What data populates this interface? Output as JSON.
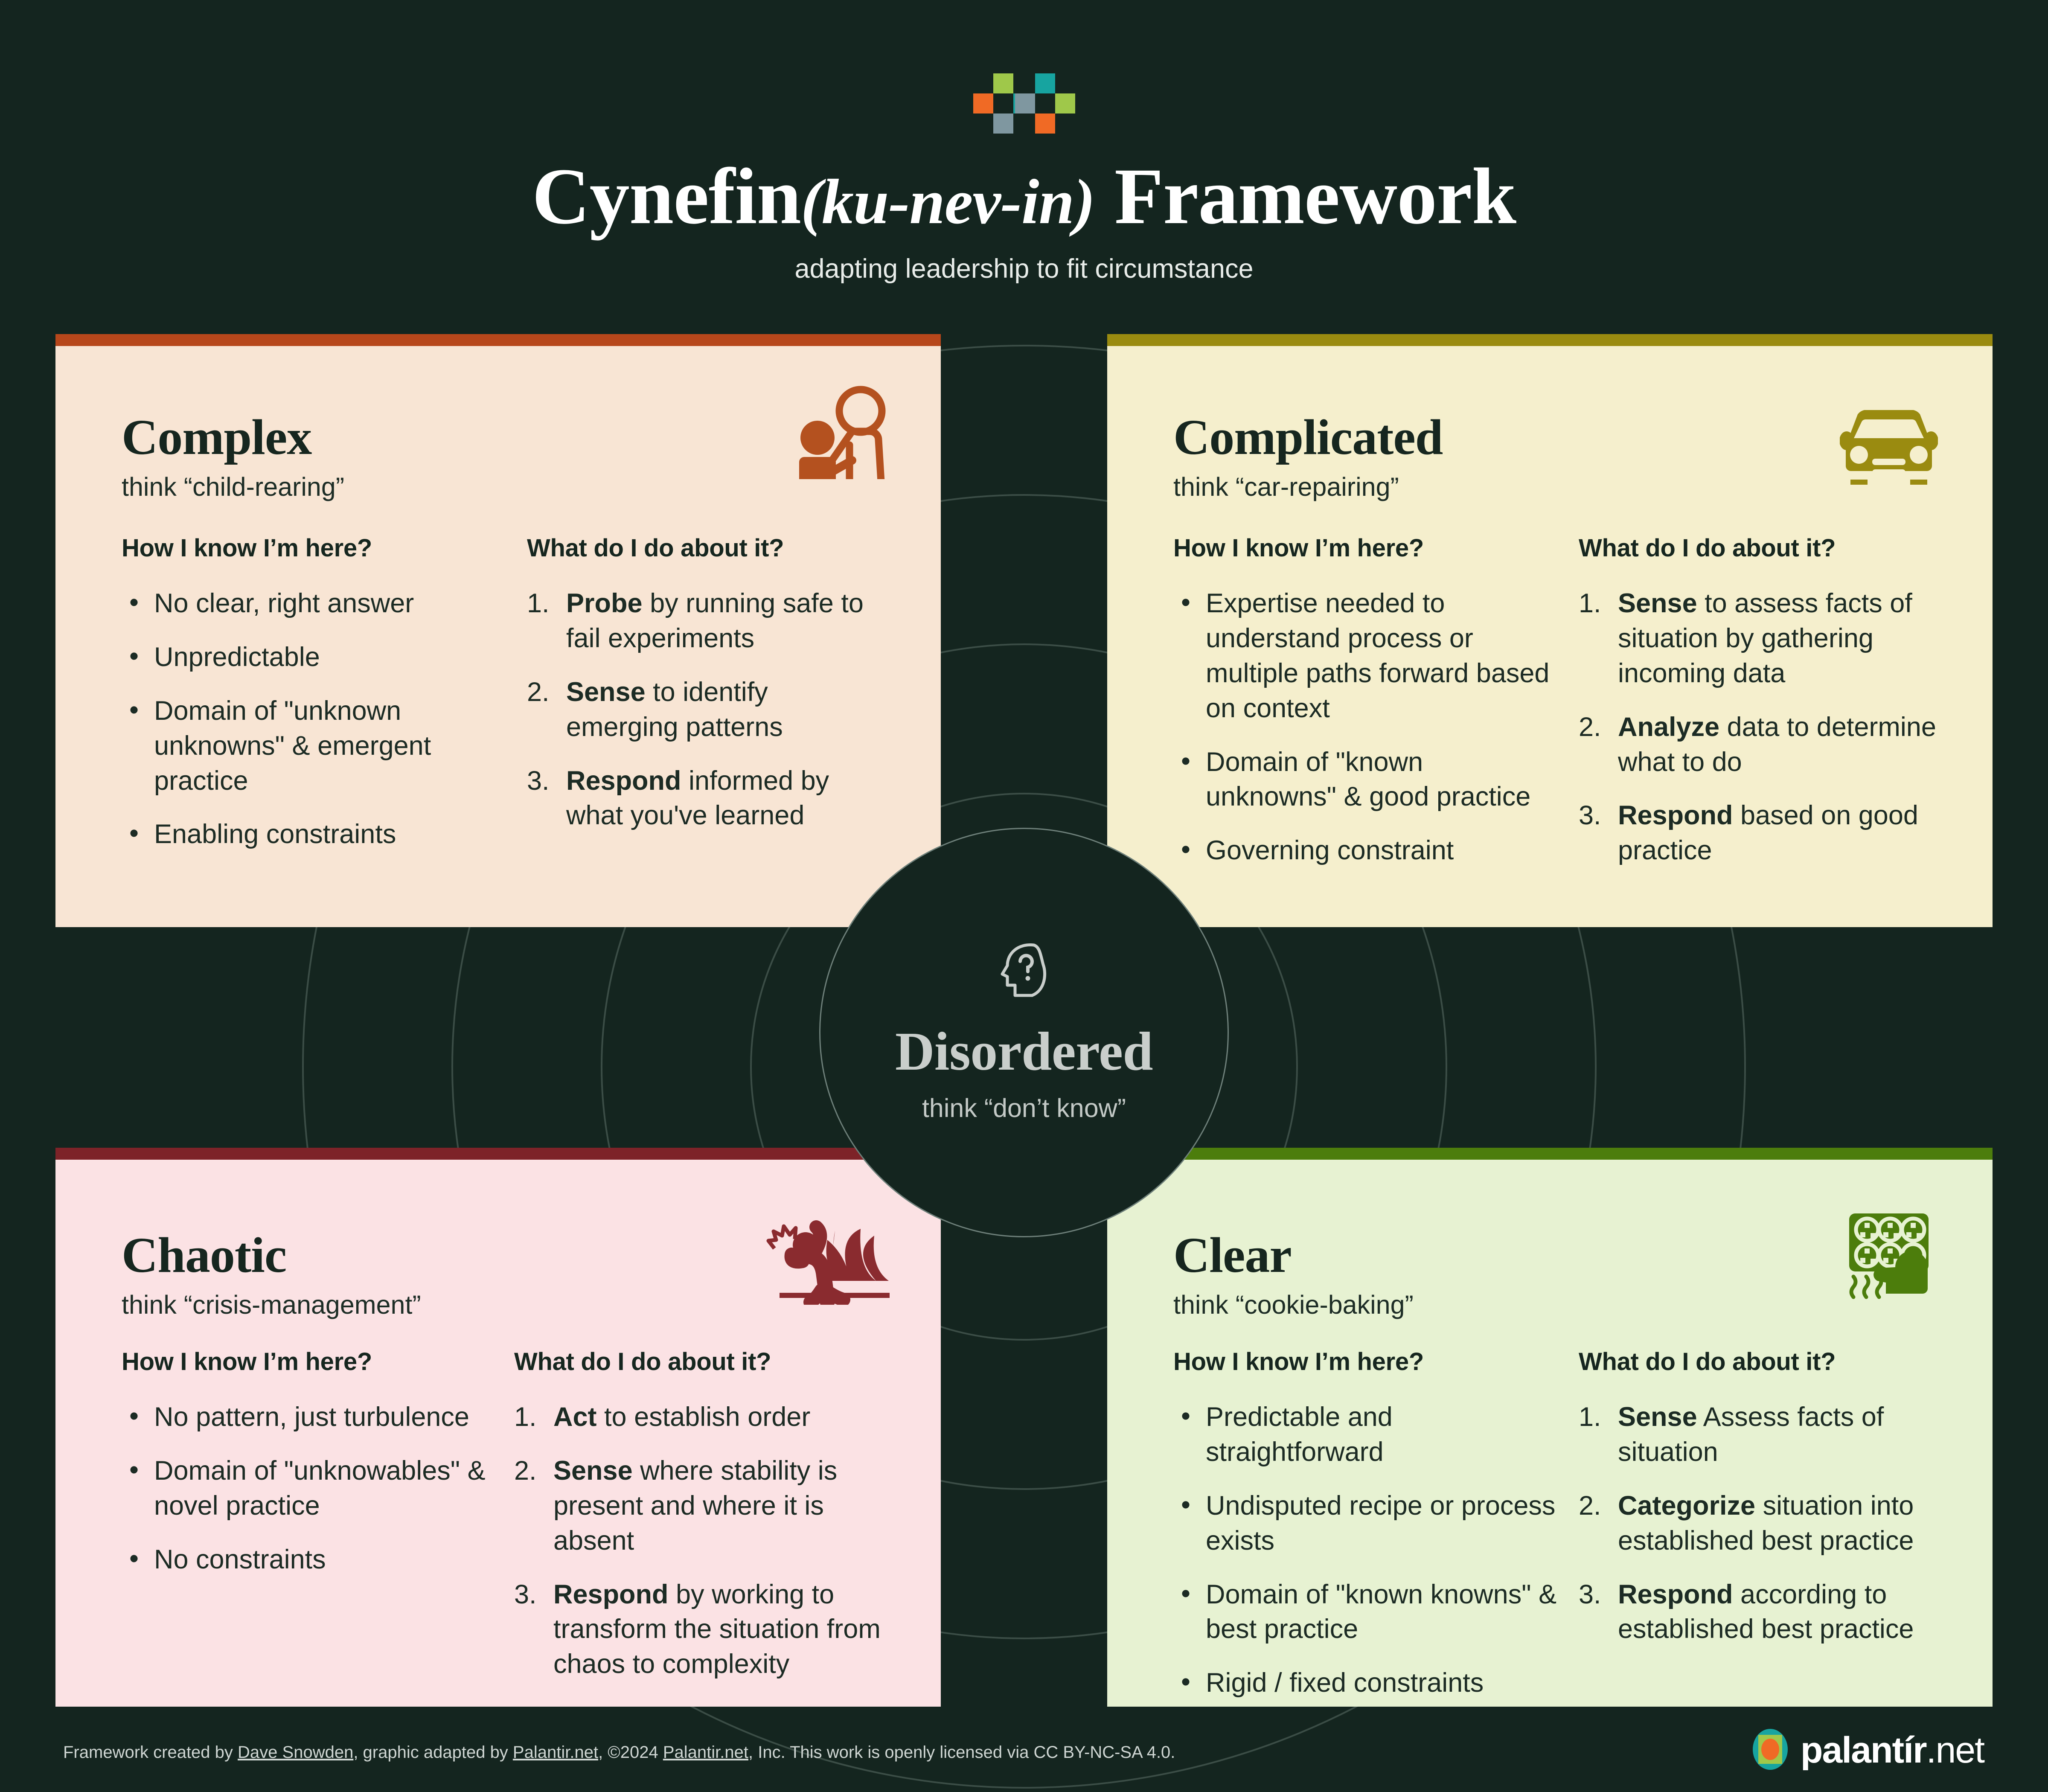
{
  "header": {
    "logo_name": "palantir-squares-logo",
    "title_main": "Cynefin",
    "title_pronunciation": "(ku-nev-in)",
    "title_tail": "Framework",
    "subtitle": "adapting leadership to fit circumstance"
  },
  "colors": {
    "page_bg": "#14251f",
    "complex_bar": "#b7471b",
    "complex_bg": "#f8e5d4",
    "complex_icon": "#b4511f",
    "complicated_bar": "#9a8b10",
    "complicated_bg": "#f5efcd",
    "complicated_icon": "#9a8b10",
    "chaotic_bar": "#7d2328",
    "chaotic_bg": "#fbe2e4",
    "chaotic_icon": "#8a2b2f",
    "clear_bar": "#4c7d0c",
    "clear_bg": "#e7f2d2",
    "clear_icon": "#4c7d0c",
    "logo_green": "#9fc84a",
    "logo_teal": "#17a4a0",
    "logo_orange": "#f06a25",
    "logo_slate": "#7f97a0",
    "ring_stroke": "#3b4d46",
    "center_border": "#6d7f79"
  },
  "quadrants": [
    {
      "id": "complex",
      "title": "Complex",
      "subtitle": "think “child-rearing”",
      "icon_name": "adult-and-child-icon",
      "left_heading": "How I know I’m here?",
      "right_heading": "What do I do about it?",
      "signals": [
        "No clear, right answer",
        "Unpredictable",
        "Domain of \"unknown unknowns\" & emergent practice",
        "Enabling constraints"
      ],
      "actions": [
        {
          "lead": "Probe",
          "rest": "by running safe to fail experiments"
        },
        {
          "lead": "Sense",
          "rest": "to identify emerging patterns"
        },
        {
          "lead": "Respond",
          "rest": "informed by what you've learned"
        }
      ]
    },
    {
      "id": "complicated",
      "title": "Complicated",
      "subtitle": "think “car-repairing”",
      "icon_name": "car-icon",
      "left_heading": "How I know I’m here?",
      "right_heading": "What do I do about it?",
      "signals": [
        "Expertise needed to understand process or multiple paths forward based on context",
        "Domain of \"known unknowns\" & good practice",
        "Governing constraint"
      ],
      "actions": [
        {
          "lead": "Sense",
          "rest": "to assess facts of situation by gathering incoming data"
        },
        {
          "lead": "Analyze",
          "rest": "data to determine what to do"
        },
        {
          "lead": "Respond",
          "rest": "based on good practice"
        }
      ]
    },
    {
      "id": "chaotic",
      "title": "Chaotic",
      "subtitle": "think “crisis-management”",
      "icon_name": "person-fleeing-fire-icon",
      "left_heading": "How I know I’m here?",
      "right_heading": "What do I do about it?",
      "signals": [
        "No pattern, just turbulence",
        "Domain of \"unknowables\" & novel practice",
        "No constraints"
      ],
      "actions": [
        {
          "lead": "Act",
          "rest": "to establish order"
        },
        {
          "lead": "Sense",
          "rest": "where stability is present and where it is absent"
        },
        {
          "lead": "Respond",
          "rest": "by working to transform the situation from chaos to complexity"
        }
      ]
    },
    {
      "id": "clear",
      "title": "Clear",
      "subtitle": "think “cookie-baking”",
      "icon_name": "cookie-tray-oven-mitt-icon",
      "left_heading": "How I know I’m here?",
      "right_heading": "What do I do about it?",
      "signals": [
        "Predictable and straightforward",
        "Undisputed recipe or process exists",
        "Domain of \"known knowns\" & best practice",
        "Rigid / fixed constraints"
      ],
      "actions": [
        {
          "lead": "Sense",
          "rest": "Assess facts of situation"
        },
        {
          "lead": "Categorize",
          "rest": "situation into established best practice"
        },
        {
          "lead": "Respond",
          "rest": "according to established best practice"
        }
      ]
    }
  ],
  "center": {
    "icon_name": "head-question-mark-icon",
    "title": "Disordered",
    "subtitle": "think “don’t know”"
  },
  "footer": {
    "part1": "Framework created by ",
    "link1": "Dave Snowden",
    "part2": ", graphic adapted by ",
    "link2": "Palantir.net",
    "part3": ", ©2024 ",
    "link3": "Palantir.net",
    "part4": ", Inc. This work is openly licensed via CC BY-NC-SA 4.0."
  },
  "brand": {
    "icon_name": "palantir-eye-logo",
    "name": "palantír",
    "tld": ".net"
  }
}
